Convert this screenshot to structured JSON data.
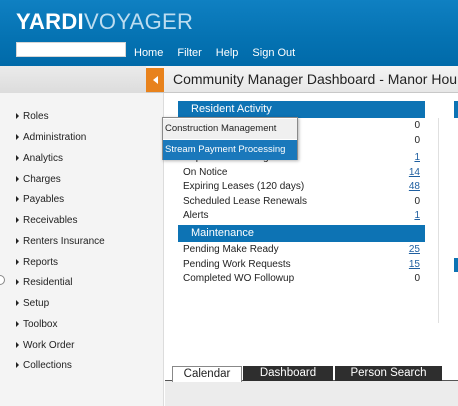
{
  "brand": {
    "part1": "YARDI",
    "part2": "VOYAGER"
  },
  "search": {
    "value": ""
  },
  "nav": [
    "Home",
    "Filter",
    "Help",
    "Sign Out"
  ],
  "page": {
    "title": "Community Manager Dashboard - Manor Hou"
  },
  "sidebar": {
    "items": [
      "Roles",
      "Administration",
      "Analytics",
      "Charges",
      "Payables",
      "Receivables",
      "Renters Insurance",
      "Reports",
      "Residential",
      "Setup",
      "Toolbox",
      "Work Order",
      "Collections"
    ]
  },
  "popup": {
    "items": [
      "Construction Management",
      "Stream Payment Processing"
    ]
  },
  "resident_activity": {
    "title": "Resident Activity",
    "rows": [
      {
        "label": "",
        "value": "0",
        "link": false
      },
      {
        "label": "",
        "value": "0",
        "link": false
      },
      {
        "label": "Deposit Accounting",
        "value": "1",
        "link": true
      },
      {
        "label": "On Notice",
        "value": "14",
        "link": true
      },
      {
        "label": "Expiring Leases (120 days)",
        "value": "48",
        "link": true
      },
      {
        "label": "Scheduled Lease Renewals",
        "value": "0",
        "link": false
      },
      {
        "label": "Alerts",
        "value": "1",
        "link": true
      }
    ]
  },
  "maintenance": {
    "title": "Maintenance",
    "rows": [
      {
        "label": "Pending Make Ready",
        "value": "25",
        "link": true
      },
      {
        "label": "Pending Work Requests",
        "value": "15",
        "link": true
      },
      {
        "label": "Completed WO Followup",
        "value": "0",
        "link": false
      }
    ]
  },
  "tabs": [
    "Calendar",
    "Dashboard",
    "Person Search"
  ],
  "colors": {
    "header_blue": "#0573b3",
    "section_blue": "#0d73b4",
    "collapse_orange": "#e8821c",
    "link_blue": "#1f5fa0"
  }
}
